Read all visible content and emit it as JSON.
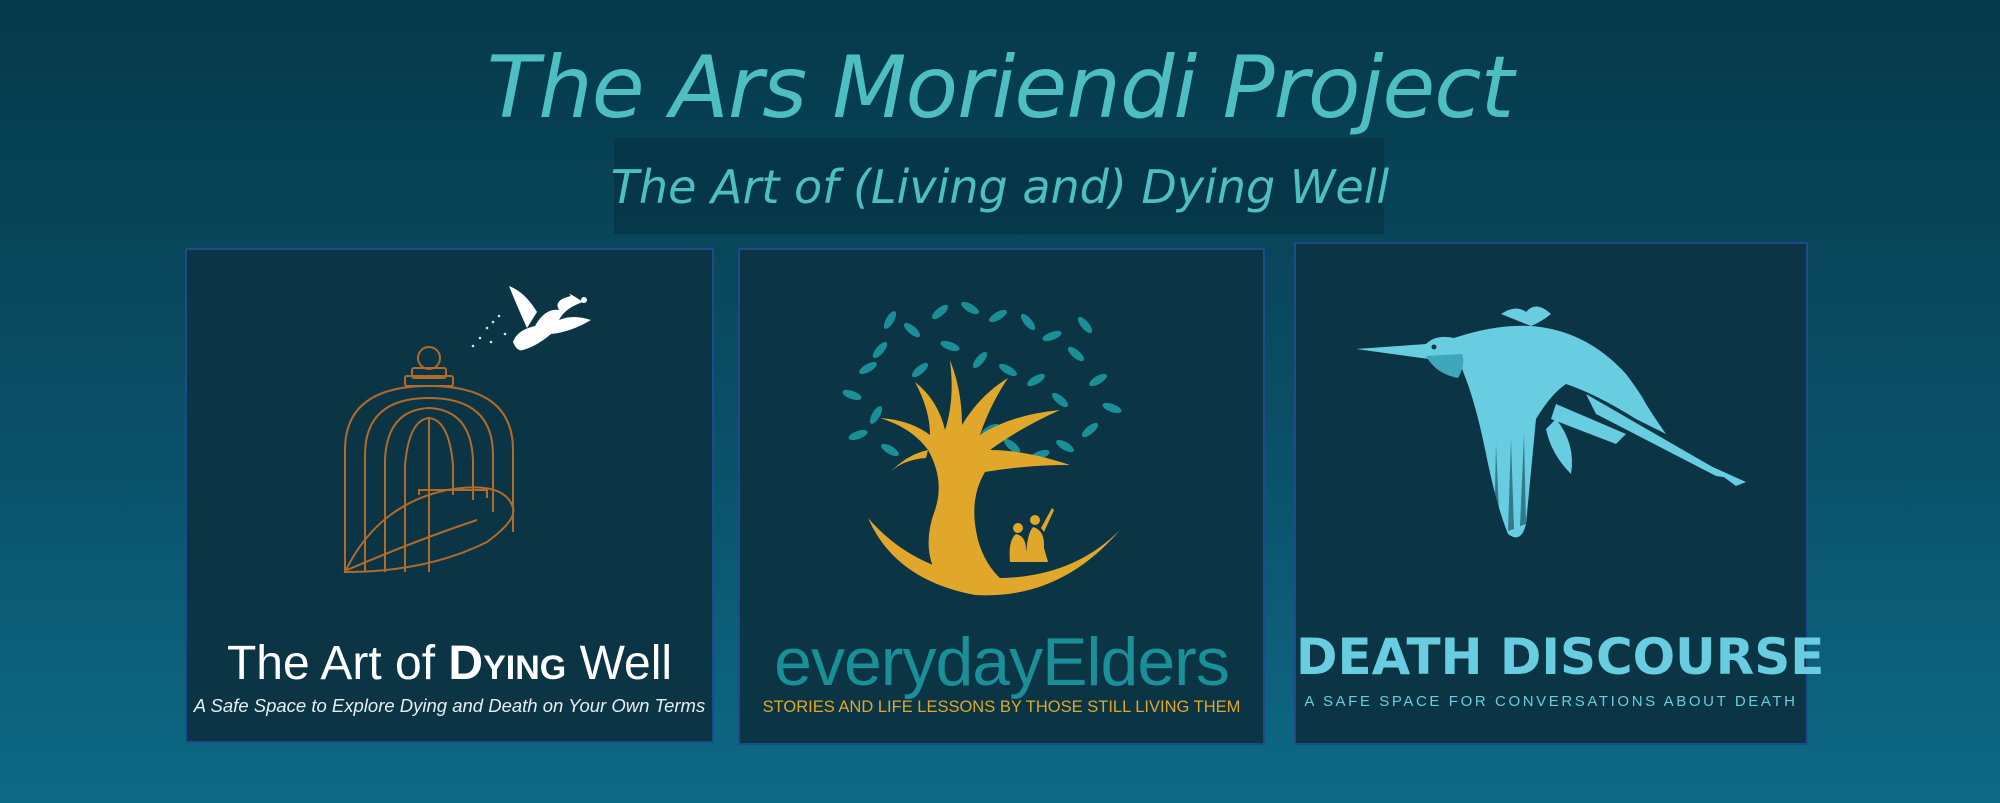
{
  "header": {
    "title": "The Ars Moriendi Project",
    "subtitle": "The Art of (Living and) Dying Well"
  },
  "cards": [
    {
      "title_prefix": "The Art of",
      "title_emphasis": "Dying",
      "title_suffix": "Well",
      "tagline": "A Safe Space to Explore Dying and Death on Your Own Terms",
      "icon": "birdcage-with-dove-icon"
    },
    {
      "title": "everydayElders",
      "tagline": "STORIES AND LIFE LESSONS BY THOSE STILL LIVING THEM",
      "icon": "tree-with-elders-icon"
    },
    {
      "title": "DEATH DISCOURSE",
      "tagline": "A SAFE SPACE FOR CONVERSATIONS ABOUT DEATH",
      "icon": "heron-icon"
    }
  ],
  "colors": {
    "background_top": "#05394a",
    "background_bottom": "#0d6a86",
    "title_teal": "#4dbfc2",
    "card_bg": "#0b3545",
    "card_border": "#1d4a8c",
    "cage_copper": "#b06a2a",
    "tree_gold": "#e0a72a",
    "leaf_teal": "#1a8f98",
    "heron_blue": "#68cde0"
  }
}
